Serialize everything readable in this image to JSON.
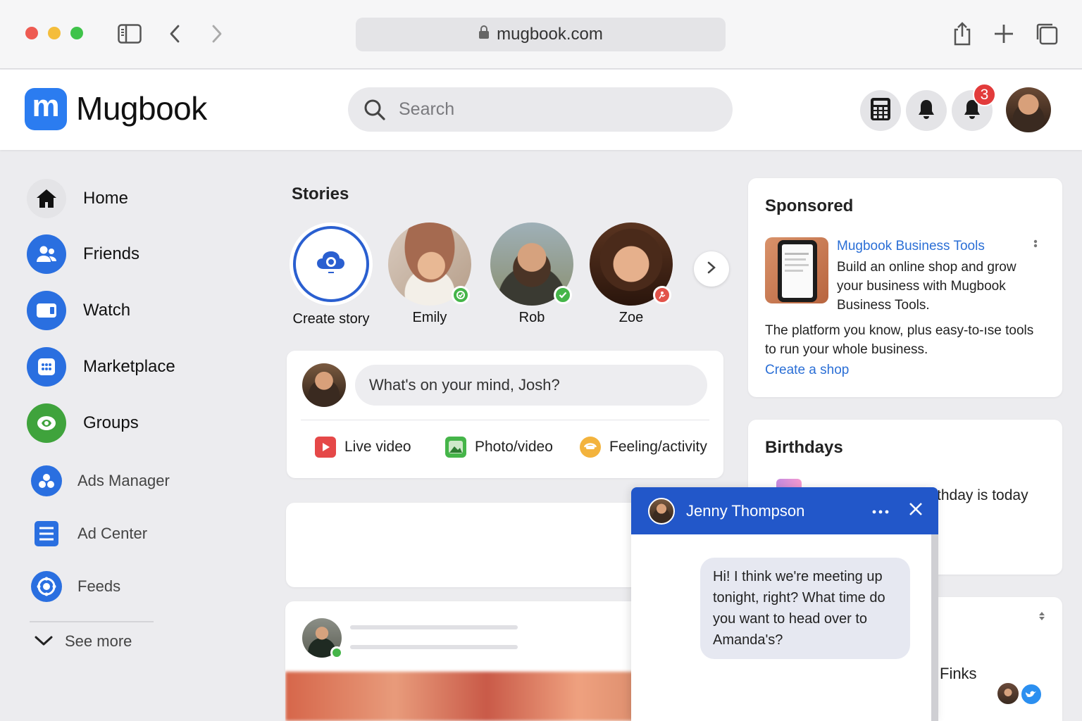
{
  "browser": {
    "url": "mugbook.com"
  },
  "app": {
    "logo_letter": "m",
    "name": "Mugbook"
  },
  "search": {
    "placeholder": "Search"
  },
  "header": {
    "notification_count": "3"
  },
  "sidebar": {
    "items": [
      {
        "label": "Home",
        "icon": "home-icon"
      },
      {
        "label": "Friends",
        "icon": "friends-icon"
      },
      {
        "label": "Watch",
        "icon": "watch-icon"
      },
      {
        "label": "Marketplace",
        "icon": "marketplace-icon"
      },
      {
        "label": "Groups",
        "icon": "groups-icon"
      },
      {
        "label": "Ads Manager",
        "icon": "ads-manager-icon"
      },
      {
        "label": "Ad Center",
        "icon": "ad-center-icon"
      },
      {
        "label": "Feeds",
        "icon": "feeds-icon"
      }
    ],
    "see_more": "See more"
  },
  "stories": {
    "title": "Stories",
    "items": [
      {
        "label": "Create story"
      },
      {
        "label": "Emily",
        "status": "online"
      },
      {
        "label": "Rob",
        "status": "online"
      },
      {
        "label": "Zoe",
        "status": "activity"
      }
    ]
  },
  "composer": {
    "placeholder": "What's on your mind, Josh?",
    "actions": [
      {
        "label": "Live video",
        "color": "#e54848"
      },
      {
        "label": "Photo/video",
        "color": "#45b549"
      },
      {
        "label": "Feeling/activity",
        "color": "#f3b33d"
      }
    ]
  },
  "sponsored": {
    "title": "Sponsored",
    "ad_title": "Mugbook Business Tools",
    "ad_desc": "Build an online shop and grow your business with Mugbook Business Tools.",
    "body": "The platform you know, plus easy-to-ıse tools to run your whole business.",
    "cta": "Create a shop"
  },
  "birthdays": {
    "title": "Birthdays",
    "text_visible": "thday is today"
  },
  "contacts": {
    "partial_name": "Finks"
  },
  "chat": {
    "name": "Jenny Thompson",
    "message": "Hi! I think we're meeting up tonight, right? What time do you want to head over to Amanda's?"
  },
  "colors": {
    "brand": "#2b7cf0",
    "chat_header": "#2257c9",
    "badge": "#e23b3b"
  }
}
